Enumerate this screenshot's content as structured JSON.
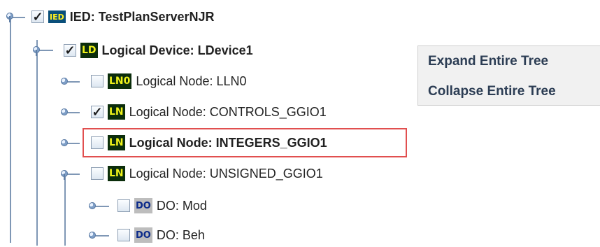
{
  "tree": {
    "nodes": [
      {
        "id": "ied",
        "badge": "IED",
        "badge_type": "ied",
        "label": "IED: TestPlanServerNJR",
        "checked": true,
        "bold": true
      },
      {
        "id": "ld",
        "badge": "LD",
        "badge_type": "ld",
        "label": "Logical Device: LDevice1",
        "checked": true,
        "bold": true
      },
      {
        "id": "lln0",
        "badge": "LN0",
        "badge_type": "lno",
        "label": "Logical Node: LLN0",
        "checked": false,
        "bold": false
      },
      {
        "id": "controls",
        "badge": "LN",
        "badge_type": "ln",
        "label": "Logical Node: CONTROLS_GGIO1",
        "checked": true,
        "bold": false
      },
      {
        "id": "integers",
        "badge": "LN",
        "badge_type": "ln",
        "label": "Logical Node: INTEGERS_GGIO1",
        "checked": false,
        "bold": true,
        "selected": true
      },
      {
        "id": "unsigned",
        "badge": "LN",
        "badge_type": "ln",
        "label": "Logical Node: UNSIGNED_GGIO1",
        "checked": false,
        "bold": false
      },
      {
        "id": "mod",
        "badge": "DO",
        "badge_type": "do",
        "label": "DO: Mod",
        "checked": false,
        "bold": false
      },
      {
        "id": "beh",
        "badge": "DO",
        "badge_type": "do",
        "label": "DO: Beh",
        "checked": false,
        "bold": false
      }
    ]
  },
  "context_menu": {
    "items": [
      "Expand Entire Tree",
      "Collapse Entire Tree"
    ]
  },
  "colors": {
    "selection_border": "#e14f4f",
    "tree_line": "#7f97b5",
    "badge_ied_bg": "#0a4f7a",
    "badge_ln_bg": "#0b2d0b",
    "badge_do_bg": "#bdbdbd",
    "badge_text_yellow": "#eef21a",
    "badge_text_blue": "#0b2a8a"
  }
}
